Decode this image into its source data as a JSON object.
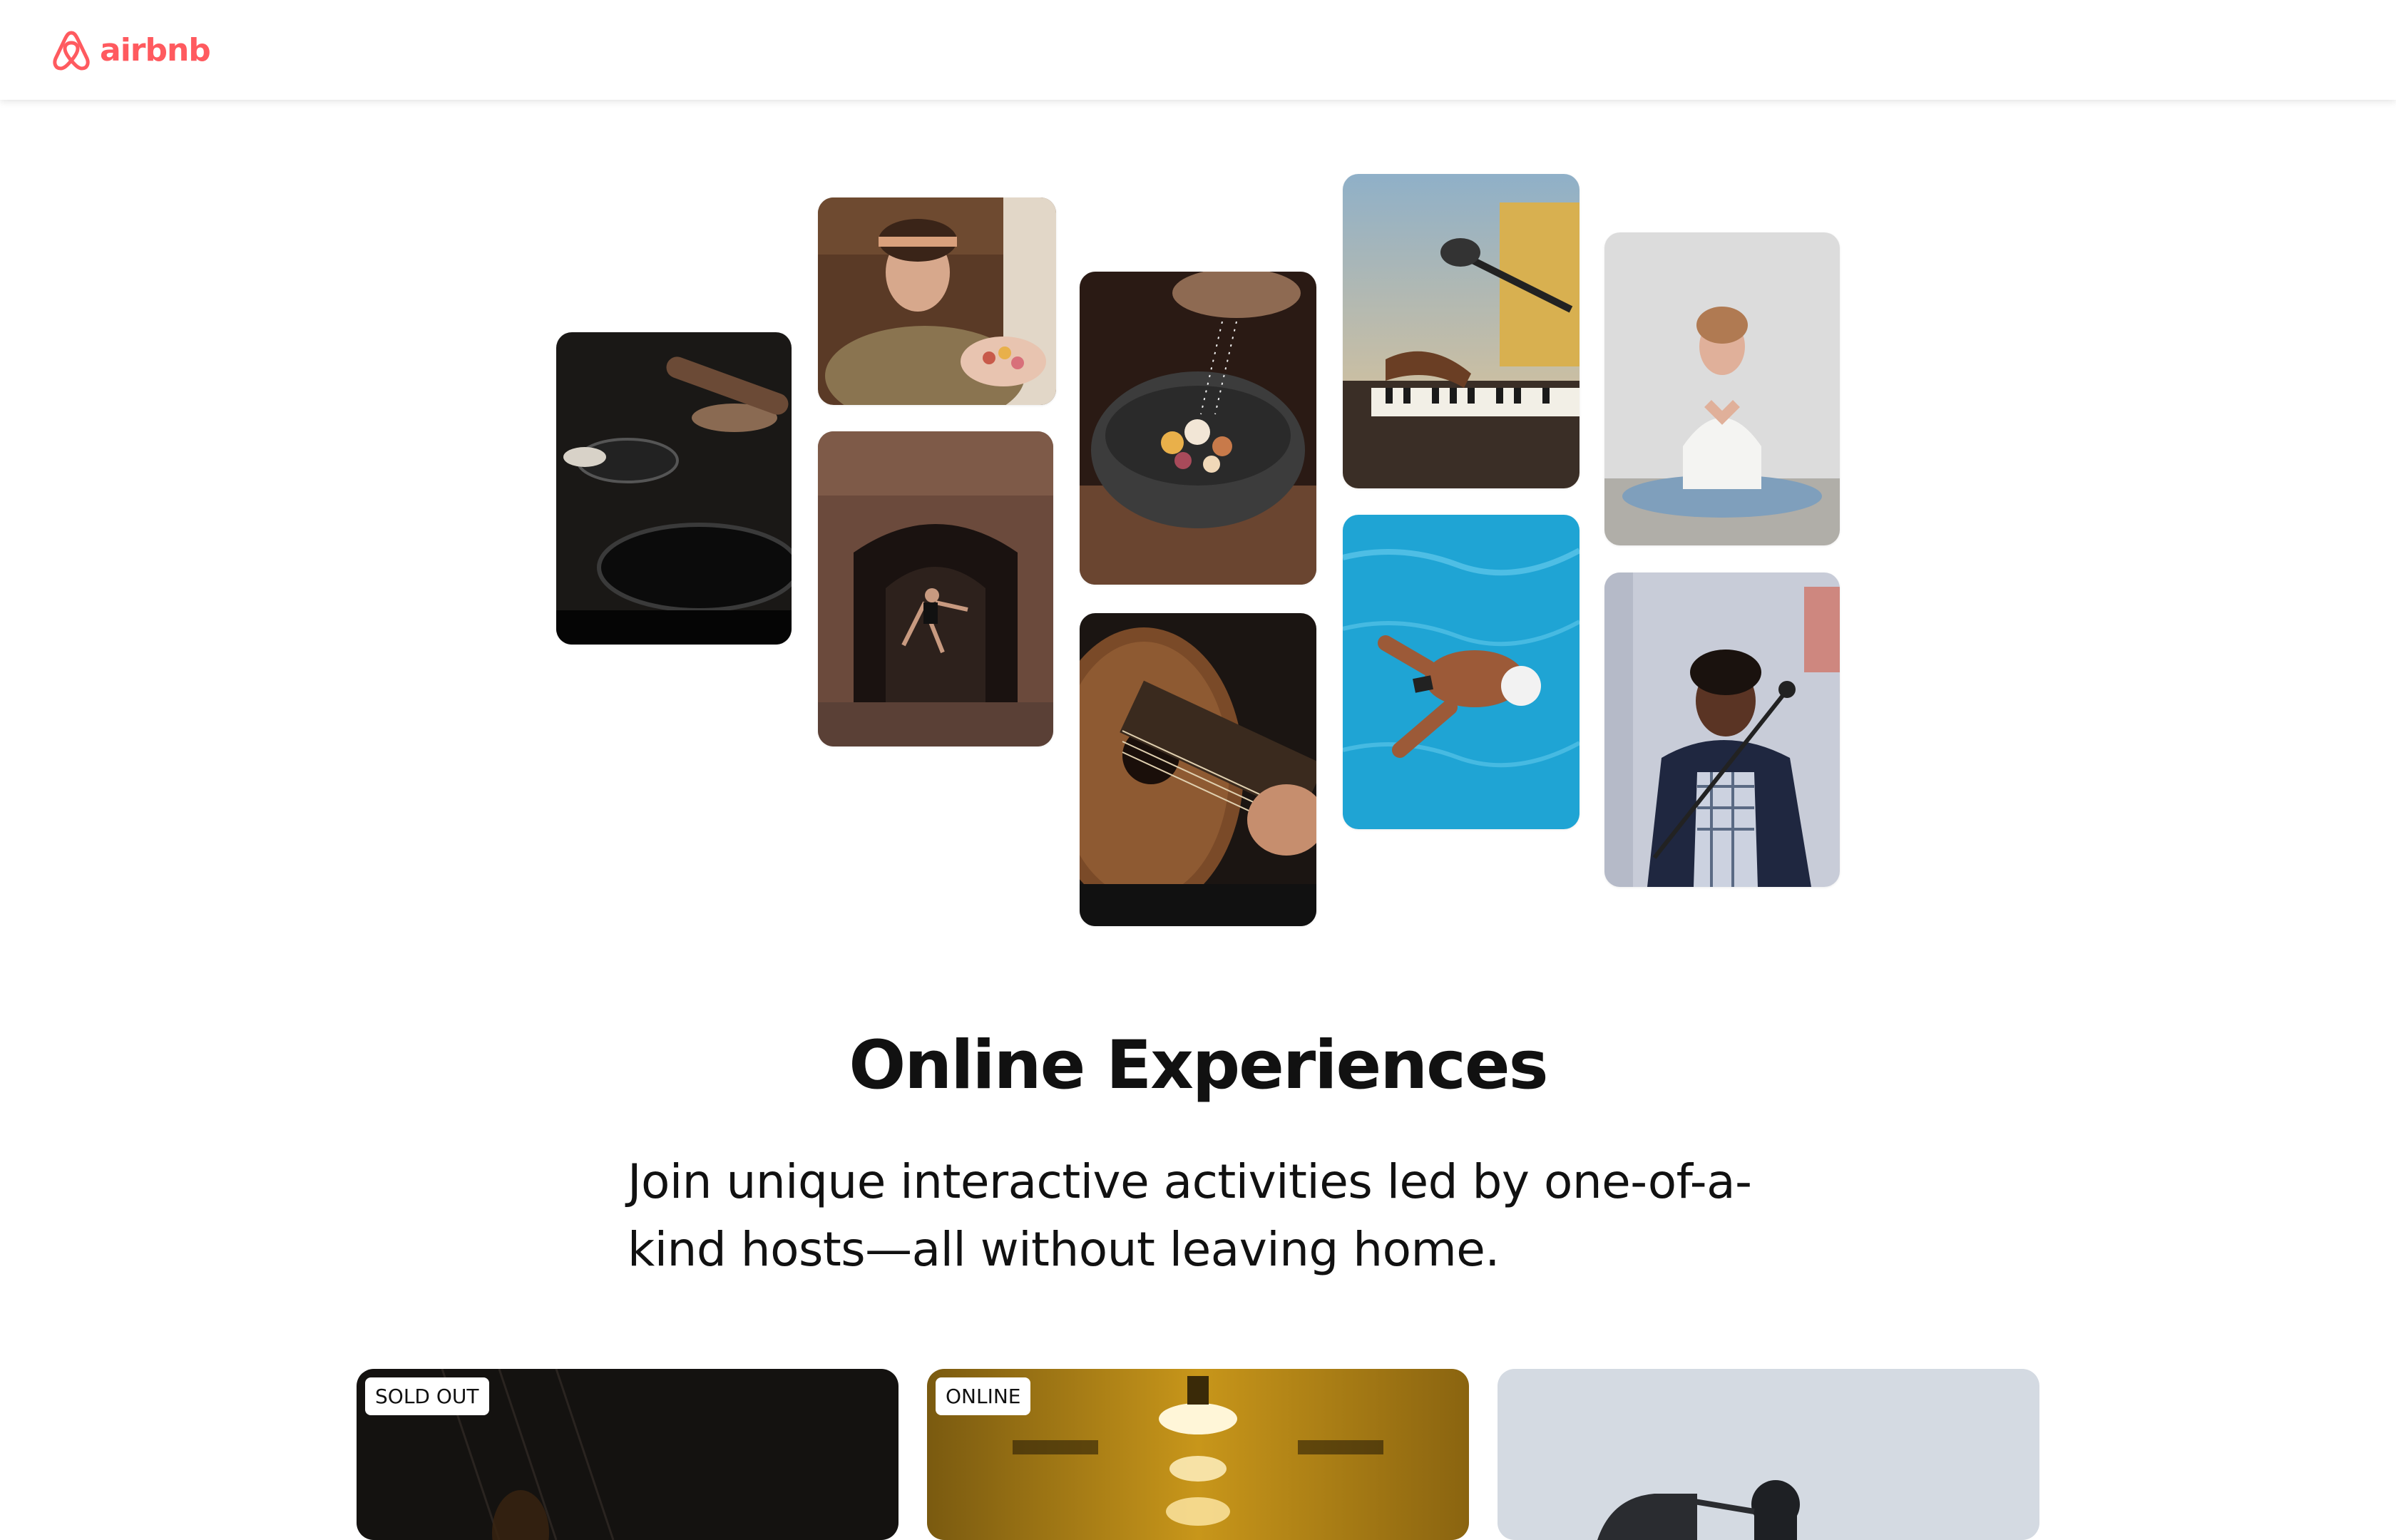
{
  "brand": {
    "name": "airbnb",
    "color": "#FF5A5F"
  },
  "hero": {
    "photos": [
      {
        "subject": "cooking pans on stove",
        "icon": "cooking-photo"
      },
      {
        "subject": "woman holding macarons",
        "icon": "baking-photo"
      },
      {
        "subject": "ballet dancer in archway",
        "icon": "dance-photo"
      },
      {
        "subject": "salt over stone bowl dish",
        "icon": "food-photo"
      },
      {
        "subject": "acoustic guitar",
        "icon": "guitar-photo"
      },
      {
        "subject": "piano with microphone",
        "icon": "piano-photo"
      },
      {
        "subject": "swimmer in pool",
        "icon": "swimming-photo"
      },
      {
        "subject": "woman meditating",
        "icon": "yoga-photo"
      },
      {
        "subject": "singer at microphone",
        "icon": "singing-photo"
      }
    ]
  },
  "main": {
    "title": "Online Experiences",
    "subtitle_line1": "Join unique interactive activities led by one-of-a-",
    "subtitle_line2": "kind hosts—all without leaving home."
  },
  "cards": [
    {
      "badge": "SOLD OUT",
      "theme": "dark"
    },
    {
      "badge": "ONLINE",
      "theme": "amber"
    },
    {
      "badge": "",
      "theme": "light-gray"
    }
  ]
}
